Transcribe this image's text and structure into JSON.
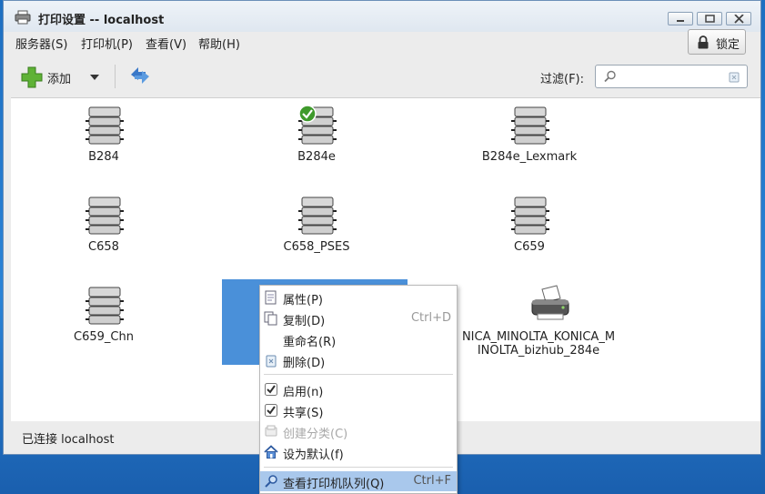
{
  "window": {
    "title": "打印设置 -- localhost"
  },
  "menubar": {
    "items": [
      "服务器(S)",
      "打印机(P)",
      "查看(V)",
      "帮助(H)"
    ]
  },
  "lock_button": {
    "label": "锁定"
  },
  "toolbar": {
    "add_label": "添加",
    "filter_label": "过滤(F):",
    "filter_value": ""
  },
  "printers": [
    {
      "name": "B284",
      "default": false,
      "type": "server"
    },
    {
      "name": "B284e",
      "default": true,
      "type": "server"
    },
    {
      "name": "B284e_Lexmark",
      "default": false,
      "type": "server"
    },
    {
      "name": "C658",
      "default": false,
      "type": "server"
    },
    {
      "name": "C658_PSES",
      "default": false,
      "type": "server"
    },
    {
      "name": "C659",
      "default": false,
      "type": "server"
    },
    {
      "name": "C659_Chn",
      "default": false,
      "type": "server"
    },
    {
      "name": "",
      "default": false,
      "type": "server",
      "selected": true
    },
    {
      "name": "KONICA_MINOLTA_KONICA_MINOLTA_bizhub_284e",
      "label_lines": [
        "NICA_MINOLTA_KONICA_M",
        "INOLTA_bizhub_284e"
      ],
      "default": false,
      "type": "inkjet"
    }
  ],
  "status": {
    "text": "已连接 localhost"
  },
  "context_menu": {
    "items": [
      {
        "label": "属性(P)",
        "shortcut": "",
        "icon": "properties-icon",
        "enabled": true
      },
      {
        "label": "复制(D)",
        "shortcut": "Ctrl+D",
        "icon": "copy-icon",
        "enabled": true
      },
      {
        "label": "重命名(R)",
        "shortcut": "",
        "icon": "",
        "enabled": true
      },
      {
        "label": "删除(D)",
        "shortcut": "",
        "icon": "delete-icon",
        "enabled": true
      },
      {
        "label": "启用(n)",
        "shortcut": "",
        "icon": "checkbox-checked-icon",
        "enabled": true,
        "checked": true
      },
      {
        "label": "共享(S)",
        "shortcut": "",
        "icon": "checkbox-checked-icon",
        "enabled": true,
        "checked": true
      },
      {
        "label": "创建分类(C)",
        "shortcut": "",
        "icon": "create-class-icon",
        "enabled": false
      },
      {
        "label": "设为默认(f)",
        "shortcut": "",
        "icon": "home-icon",
        "enabled": true
      },
      {
        "label": "查看打印机队列(Q)",
        "shortcut": "Ctrl+F",
        "icon": "queue-search-icon",
        "enabled": true,
        "highlighted": true
      }
    ]
  },
  "colors": {
    "selection": "#4a90d9",
    "menu_highlight": "#a9c8ec",
    "desktop": "#2b83d6"
  }
}
